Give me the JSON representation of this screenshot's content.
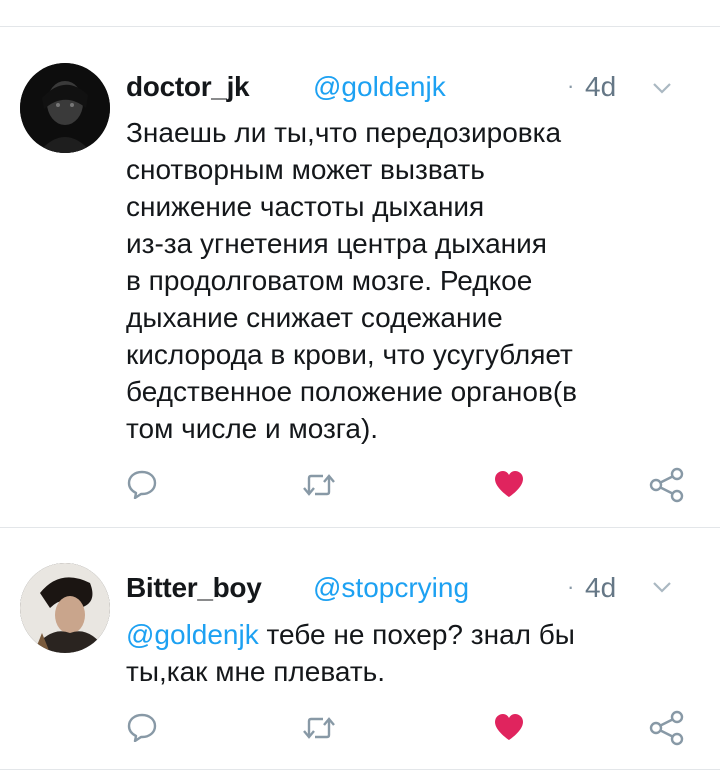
{
  "tweets": [
    {
      "name": "doctor_jk",
      "handle": "@goldenjk",
      "dot": "·",
      "time": "4d",
      "text": "Знаешь ли ты,что передозировка\nснотворным может вызвать\nснижение частоты дыхания\nиз-за угнетения центра дыхания\nв продолговатом мозге. Редкое\nдыхание снижает содежание\nкислорода в крови, что усугубляет\nбедственное положение органов(в\nтом числе и мозга).",
      "liked": true
    },
    {
      "name": "Bitter_boy",
      "handle": "@stopcrying",
      "dot": "·",
      "time": "4d",
      "mention": "@goldenjk",
      "text": " тебе не похер? знал  бы\nты,как мне плевать.",
      "liked": true
    }
  ],
  "colors": {
    "accent": "#1da1f2",
    "like": "#e0245e",
    "icon_gray": "#8899a6",
    "divider": "#e3e6e9"
  },
  "icons": [
    "reply-icon",
    "retweet-icon",
    "like-heart-icon",
    "share-icon",
    "chevron-down-icon"
  ]
}
